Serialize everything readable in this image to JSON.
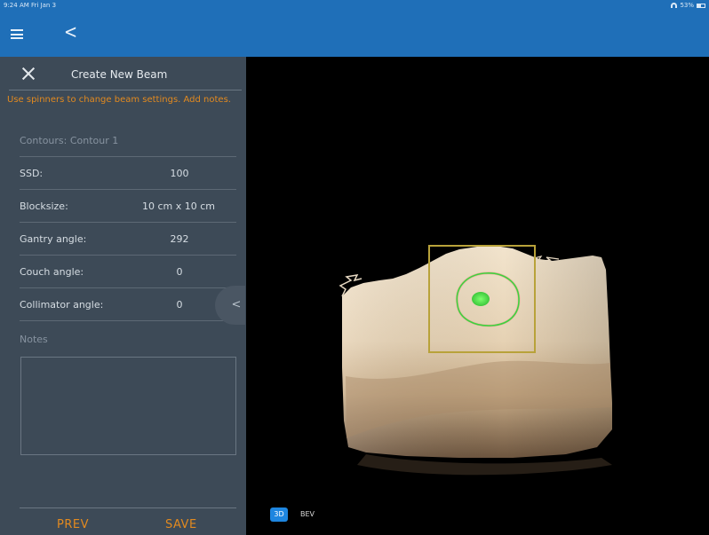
{
  "status_bar": {
    "time": "9:24 AM  Fri Jan 3",
    "battery": "53%"
  },
  "panel": {
    "title": "Create New Beam",
    "hint": "Use spinners to change beam settings. Add notes.",
    "contours_label": "Contours: Contour 1",
    "fields": [
      {
        "label": "SSD:",
        "value": "100"
      },
      {
        "label": "Blocksize:",
        "value": "10 cm x 10 cm"
      },
      {
        "label": "Gantry angle:",
        "value": "292"
      },
      {
        "label": "Couch angle:",
        "value": "0"
      },
      {
        "label": "Collimator angle:",
        "value": "0"
      }
    ],
    "notes_label": "Notes",
    "notes_value": "",
    "prev_label": "PREV",
    "save_label": "SAVE"
  },
  "view": {
    "mode_3d_label": "3D",
    "mode_bev_label": "BEV",
    "active_mode": "3D"
  },
  "colors": {
    "nav": "#1f6fb8",
    "panel": "#3d4a57",
    "accent": "#e38a1f",
    "contour": "#3fd13f",
    "field_box": "#b8a23a"
  }
}
